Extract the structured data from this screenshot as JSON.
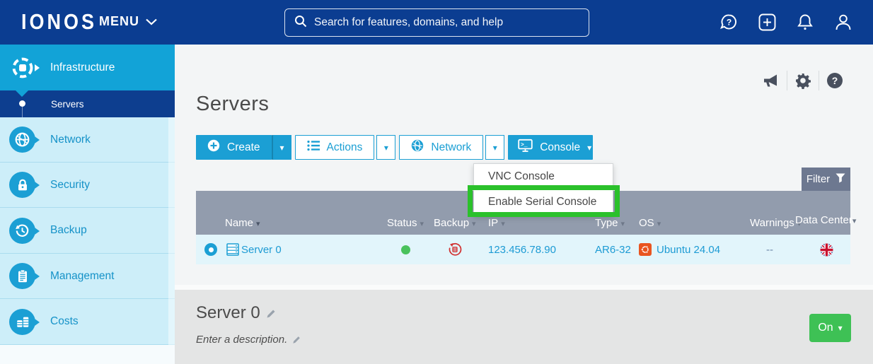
{
  "navbar": {
    "logo": "IONOS",
    "menu_label": "MENU",
    "search_placeholder": "Search for features, domains, and help"
  },
  "sidebar": {
    "items": [
      {
        "label": "Infrastructure",
        "active": true
      },
      {
        "label": "Servers",
        "active": true,
        "sub_item": true
      },
      {
        "label": "Network"
      },
      {
        "label": "Security"
      },
      {
        "label": "Backup"
      },
      {
        "label": "Management"
      },
      {
        "label": "Costs"
      }
    ]
  },
  "page": {
    "title": "Servers"
  },
  "toolbar": {
    "create_label": "Create",
    "actions_label": "Actions",
    "network_label": "Network",
    "console_label": "Console"
  },
  "console_menu": {
    "vnc_label": "VNC Console",
    "serial_label": "Enable Serial Console",
    "highlighted_item": "Enable Serial Console"
  },
  "table": {
    "filter_label": "Filter",
    "headers": {
      "name": "Name",
      "status": "Status",
      "backup": "Backup",
      "ip": "IP",
      "type": "Type",
      "os": "OS",
      "warnings": "Warnings",
      "data_center": "Data Center"
    },
    "row": {
      "name": "Server 0",
      "status": "running",
      "backup": "none",
      "ip": "123.456.78.90",
      "type": "AR6-32",
      "os": "Ubuntu 24.04",
      "warnings": "--",
      "data_center": "United Kingdom"
    }
  },
  "detail": {
    "title": "Server 0",
    "description_placeholder": "Enter a description.",
    "power_label": "On"
  },
  "colors": {
    "navbar_blue": "#0b3d91",
    "accent_blue": "#1b9fd4",
    "sidebar_active_blue": "#12a3d7",
    "sidebar_navy": "#0d3e8f",
    "highlight_green": "#2bc12b",
    "status_green": "#49c25c",
    "backup_red": "#d13030",
    "power_green": "#3ec155",
    "header_gray": "#929cad",
    "ubuntu_orange": "#e95420"
  }
}
